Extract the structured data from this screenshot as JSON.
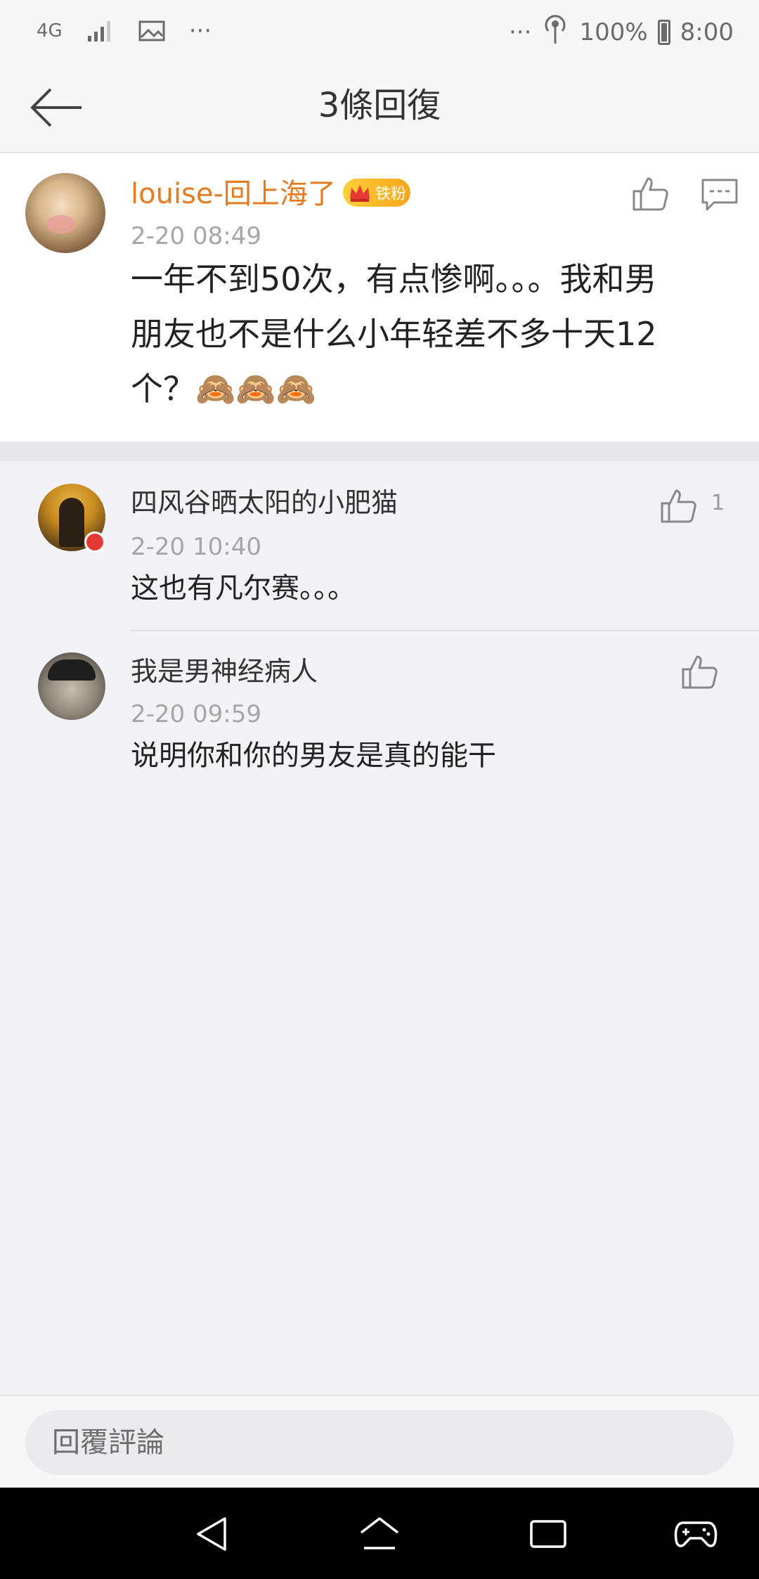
{
  "status_bar": {
    "network": "4G",
    "more": "···",
    "more_right": "···",
    "battery": "100%",
    "time": "8:00"
  },
  "header": {
    "title": "3條回復",
    "back_icon": "arrow-left-icon"
  },
  "main_comment": {
    "username": "louise-回上海了",
    "badge": "铁粉",
    "time": "2-20 08:49",
    "text_lines": [
      "一年不到50次，有点惨啊。。。我和男",
      "朋友也不是什么小年轻差不多十天12",
      "个？🙈🙈🙈"
    ]
  },
  "replies": [
    {
      "username": "四风谷晒太阳的小肥猫",
      "time": "2-20 10:40",
      "text": "这也有凡尔赛。。。",
      "likes": "1"
    },
    {
      "username": "我是男神经病人",
      "time": "2-20 09:59",
      "text": "说明你和你的男友是真的能干",
      "likes": ""
    }
  ],
  "reply_bar": {
    "placeholder": "回覆評論"
  },
  "colors": {
    "accent_orange": "#e57a1f",
    "badge_gold": "#f7a51b",
    "background": "#f2f2f7"
  }
}
